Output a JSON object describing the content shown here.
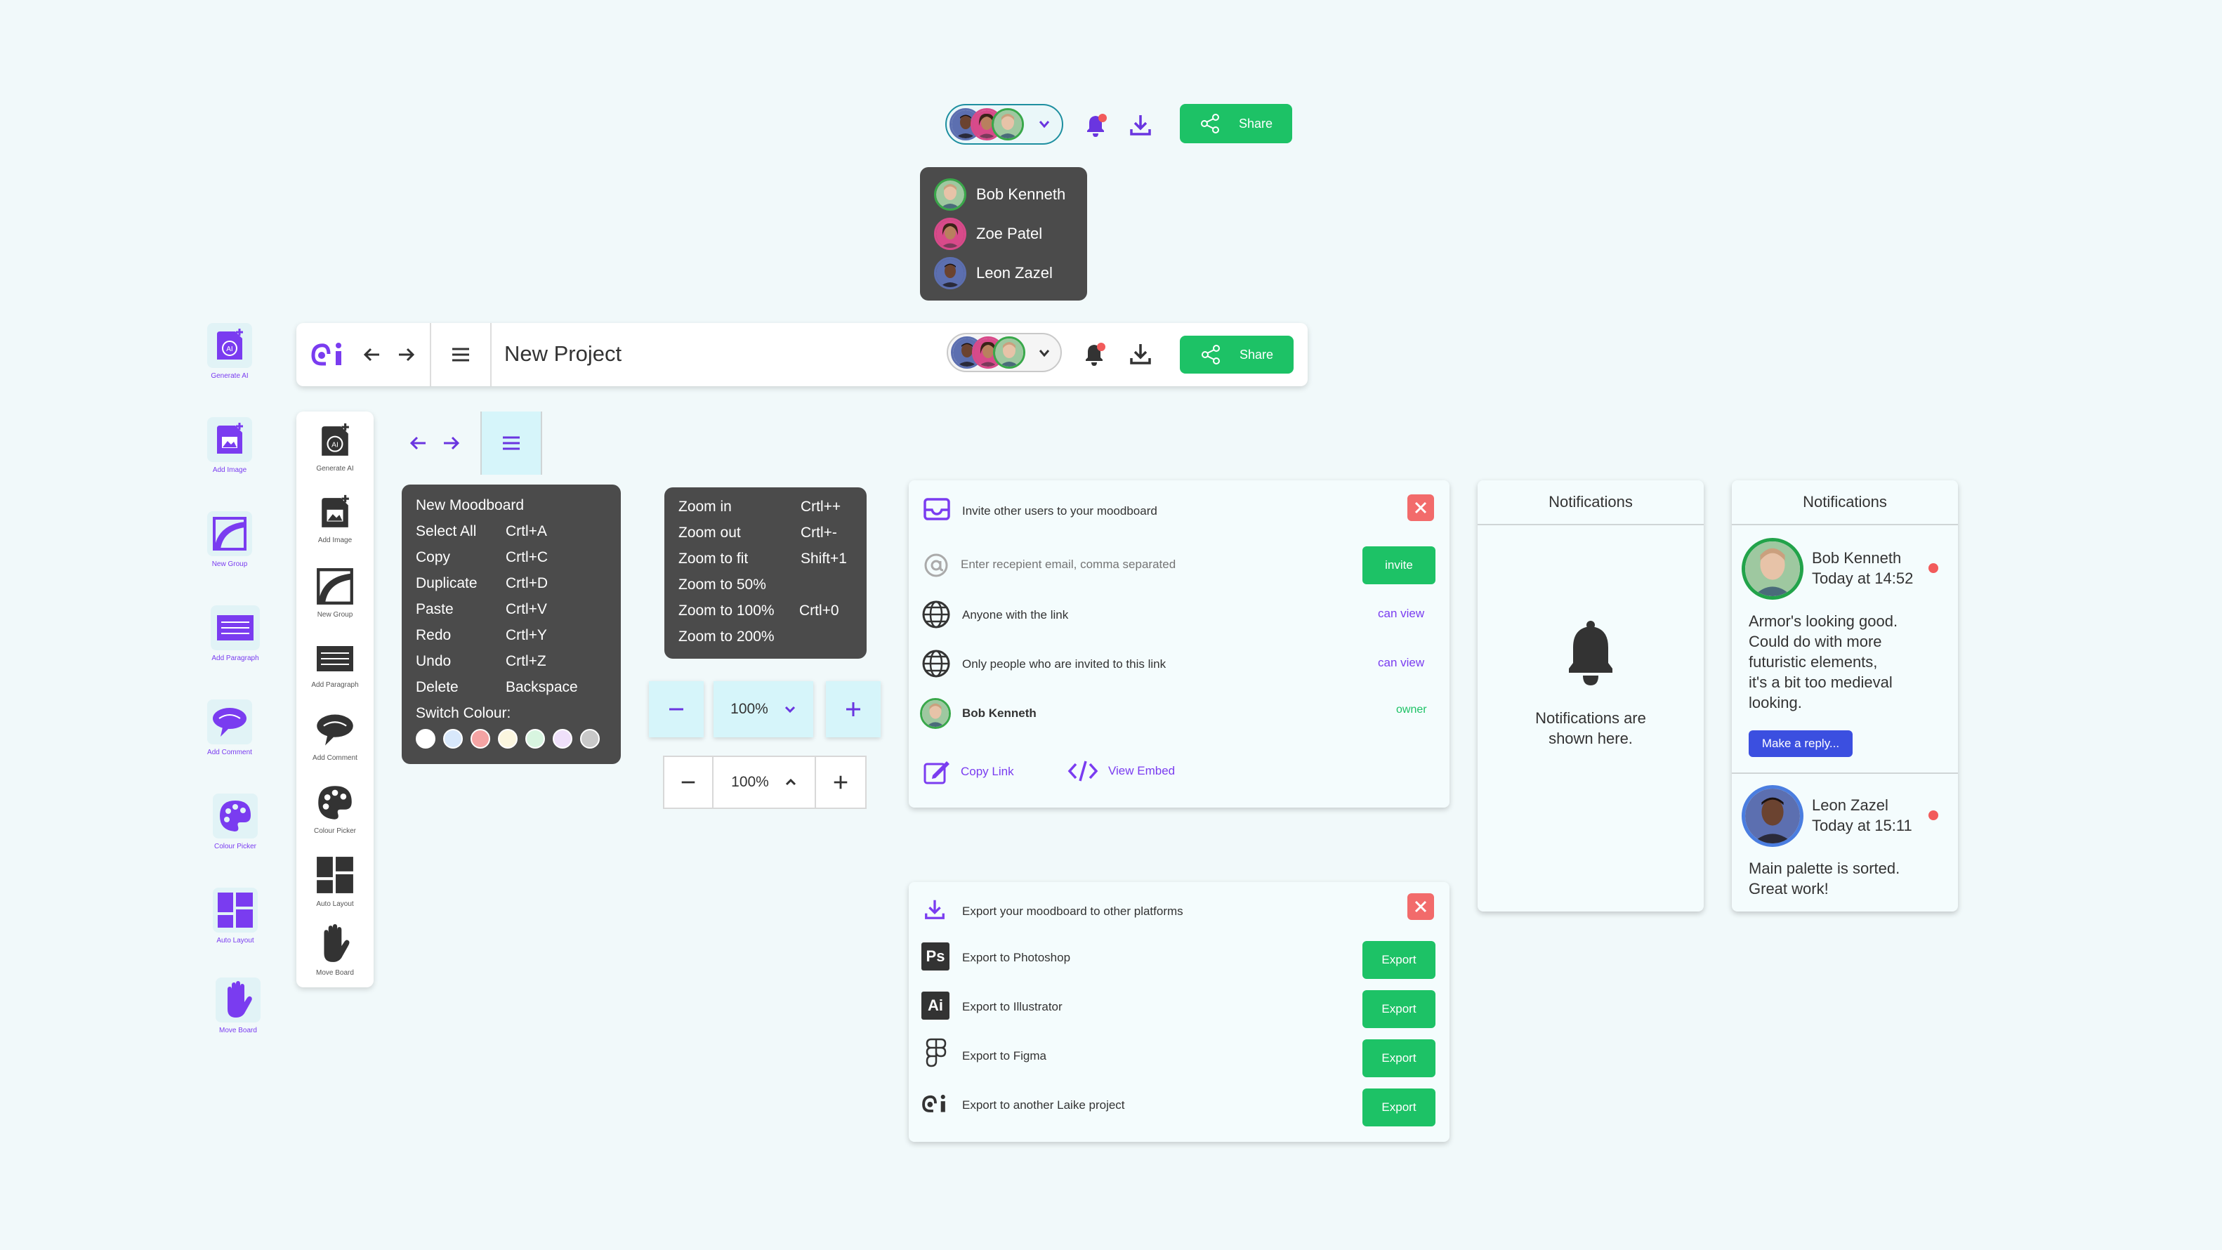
{
  "colors": {
    "accent": "#7a3cf0",
    "green": "#1dc266",
    "dark_menu": "#4b4b4b",
    "danger": "#f26b6b",
    "background": "#f1f9fa"
  },
  "top": {
    "share_label": "Share",
    "collaborators": [
      "Bob Kenneth",
      "Zoe Patel",
      "Leon Zazel"
    ]
  },
  "toolbar": {
    "project_title": "New Project",
    "share_label": "Share"
  },
  "tools_primary": [
    {
      "label": "Generate AI",
      "icon": "generate-ai-icon"
    },
    {
      "label": "Add Image",
      "icon": "add-image-icon"
    },
    {
      "label": "New Group",
      "icon": "new-group-icon"
    },
    {
      "label": "Add Paragraph",
      "icon": "add-paragraph-icon"
    },
    {
      "label": "Add Comment",
      "icon": "add-comment-icon"
    },
    {
      "label": "Colour Picker",
      "icon": "colour-picker-icon"
    },
    {
      "label": "Auto Layout",
      "icon": "auto-layout-icon"
    },
    {
      "label": "Move Board",
      "icon": "move-board-icon"
    }
  ],
  "tools_secondary": [
    {
      "label": "Generate AI"
    },
    {
      "label": "Add Image"
    },
    {
      "label": "New Group"
    },
    {
      "label": "Add Paragraph"
    },
    {
      "label": "Add Comment"
    },
    {
      "label": "Colour Picker"
    },
    {
      "label": "Auto Layout"
    },
    {
      "label": "Move Board"
    }
  ],
  "main_menu": {
    "items": [
      {
        "label": "New Moodboard",
        "shortcut": ""
      },
      {
        "label": "Select All",
        "shortcut": "Crtl+A"
      },
      {
        "label": "Copy",
        "shortcut": "Crtl+C"
      },
      {
        "label": "Duplicate",
        "shortcut": "Crtl+D"
      },
      {
        "label": "Paste",
        "shortcut": "Crtl+V"
      },
      {
        "label": "Redo",
        "shortcut": "Crtl+Y"
      },
      {
        "label": "Undo",
        "shortcut": "Crtl+Z"
      },
      {
        "label": "Delete",
        "shortcut": "Backspace"
      }
    ],
    "switch_colour_label": "Switch Colour:",
    "swatches": [
      "#ffffff",
      "#d8e8fb",
      "#f4a3a3",
      "#fbf6df",
      "#d8f5e0",
      "#efe0fa",
      "#c8c8c8"
    ]
  },
  "zoom_menu": {
    "items": [
      {
        "label": "Zoom in",
        "shortcut": "Crtl++"
      },
      {
        "label": "Zoom out",
        "shortcut": "Crtl+-"
      },
      {
        "label": "Zoom to fit",
        "shortcut": "Shift+1"
      },
      {
        "label": "Zoom to 50%",
        "shortcut": ""
      },
      {
        "label": "Zoom to 100%",
        "shortcut": "Crtl+0"
      },
      {
        "label": "Zoom to 200%",
        "shortcut": ""
      }
    ]
  },
  "zoom": {
    "value_a": "100%",
    "value_b": "100%"
  },
  "invite": {
    "title": "Invite other users to your moodboard",
    "email_placeholder": "Enter recepient email, comma separated",
    "invite_label": "invite",
    "link_anyone": "Anyone with the link",
    "link_anyone_perm": "can view",
    "link_invited": "Only people who are invited to this link",
    "link_invited_perm": "can view",
    "owner_name": "Bob Kenneth",
    "owner_role": "owner",
    "copy_link": "Copy Link",
    "view_embed": "View Embed"
  },
  "export": {
    "title": "Export your moodboard to other platforms",
    "button_label": "Export",
    "items": [
      "Export to Photoshop",
      "Export to Illustrator",
      "Export to Figma",
      "Export to another Laike project"
    ]
  },
  "notifications_empty": {
    "title": "Notifications",
    "message_1": "Notifications are",
    "message_2": "shown here."
  },
  "notifications": {
    "title": "Notifications",
    "items": [
      {
        "name": "Bob Kenneth",
        "time": "Today at 14:52",
        "body": [
          "Armor's looking good.",
          "Could do with more",
          "futuristic elements,",
          "it's a bit too medieval",
          "looking."
        ],
        "reply": "Make a reply..."
      },
      {
        "name": "Leon Zazel",
        "time": "Today at 15:11",
        "body": [
          "Main palette is sorted.",
          "Great work!"
        ]
      }
    ]
  }
}
